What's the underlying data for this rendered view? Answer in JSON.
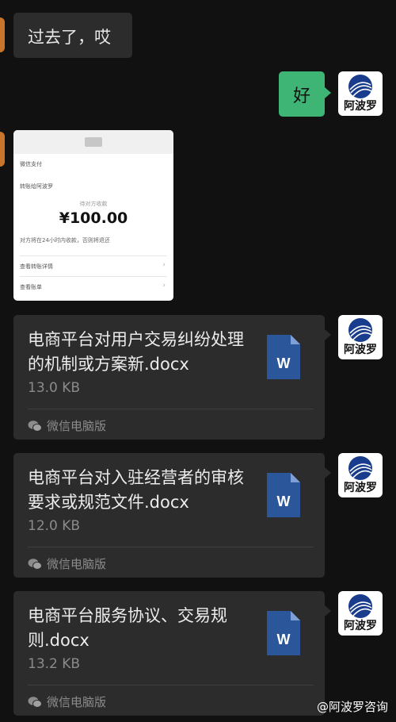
{
  "messages": {
    "incoming_text": "过去了，哎",
    "outgoing_text": "好"
  },
  "contact": {
    "avatar_name": "阿波罗"
  },
  "image_preview": {
    "line1": "微信支付",
    "line2": "转账给阿波罗",
    "line3": "待对方收款",
    "amount": "¥100.00",
    "line4": "对方将在24小时内收款，否则将退还",
    "row1": "查看转账详情",
    "row2": "查看账单"
  },
  "files": [
    {
      "name": "电商平台对用户交易纠纷处理的机制或方案新.docx",
      "size": "13.0 KB",
      "source": "微信电脑版"
    },
    {
      "name": "电商平台对入驻经营者的审核要求或规范文件.docx",
      "size": "12.0 KB",
      "source": "微信电脑版"
    },
    {
      "name": "电商平台服务协议、交易规则.docx",
      "size": "13.2 KB",
      "source": "微信电脑版"
    }
  ],
  "watermark": "@阿波罗咨询",
  "colors": {
    "background": "#111111",
    "bubble_in": "#2c2c2c",
    "bubble_out": "#3eb575",
    "word_blue": "#2b579a",
    "avatar_blue": "#1a3c8c"
  }
}
